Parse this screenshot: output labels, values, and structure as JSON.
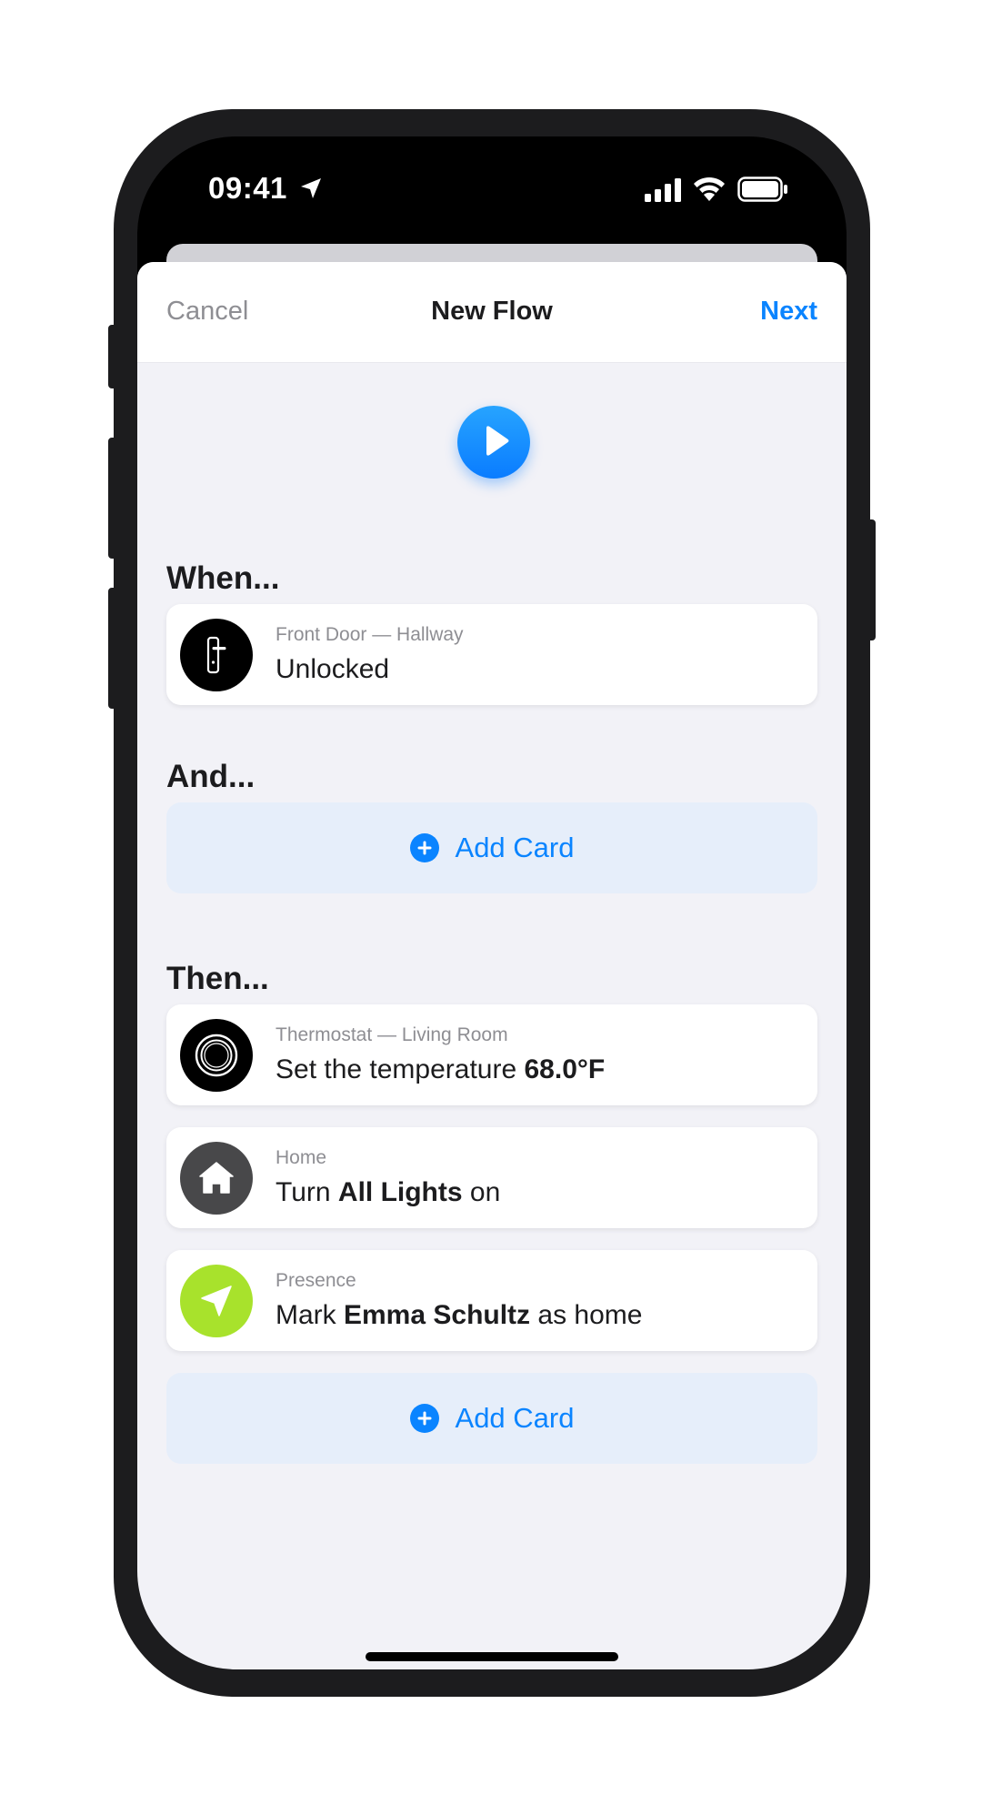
{
  "status_bar": {
    "time": "09:41",
    "icons": [
      "location-arrow-icon",
      "cellular-signal-icon",
      "wifi-icon",
      "battery-icon"
    ]
  },
  "nav": {
    "cancel_label": "Cancel",
    "title": "New Flow",
    "next_label": "Next"
  },
  "colors": {
    "accent": "#0a84ff",
    "background": "#f2f2f7",
    "add_card_bg": "#e6eefa",
    "presence_green": "#a8e22c"
  },
  "when": {
    "heading": "When...",
    "cards": [
      {
        "icon": "door-lock-icon",
        "subtitle": "Front Door — Hallway",
        "text": "Unlocked"
      }
    ]
  },
  "and": {
    "heading": "And...",
    "add_label": "Add Card"
  },
  "then": {
    "heading": "Then...",
    "cards": [
      {
        "icon": "thermostat-icon",
        "subtitle": "Thermostat — Living Room",
        "prefix": "Set the temperature ",
        "bold": "68.0°F",
        "suffix": ""
      },
      {
        "icon": "home-icon",
        "subtitle": "Home",
        "prefix": "Turn ",
        "bold": "All Lights",
        "suffix": " on"
      },
      {
        "icon": "presence-arrow-icon",
        "subtitle": "Presence",
        "prefix": "Mark ",
        "bold": "Emma Schultz",
        "suffix": " as home"
      }
    ],
    "add_label": "Add Card"
  }
}
